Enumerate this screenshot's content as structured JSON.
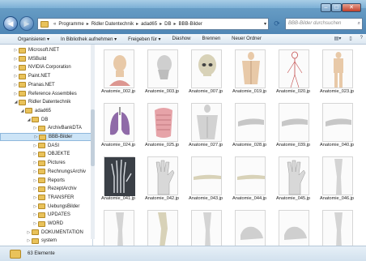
{
  "window": {
    "buttons": {
      "minimize_icon": "minimize-icon",
      "maximize_icon": "maximize-icon",
      "close_icon": "close-icon"
    }
  },
  "navigation": {
    "back_icon": "arrow-left-icon",
    "forward_icon": "arrow-right-icon",
    "breadcrumb": [
      {
        "label": "Programme"
      },
      {
        "label": "Ridler Datentechnik"
      },
      {
        "label": "adad65"
      },
      {
        "label": "DB"
      },
      {
        "label": "BBB-Bilder"
      }
    ],
    "refresh_icon": "refresh-icon",
    "search": {
      "placeholder": "BBB-Bilder durchsuchen"
    }
  },
  "toolbar": {
    "items": [
      {
        "label": "Organisieren ▾"
      },
      {
        "label": "In Bibliothek aufnehmen ▾"
      },
      {
        "label": "Freigeben für ▾"
      },
      {
        "label": "Diashow"
      },
      {
        "label": "Brennen"
      },
      {
        "label": "Neuer Ordner"
      }
    ],
    "right_icons": [
      "view-options-icon",
      "preview-pane-icon",
      "help-icon"
    ]
  },
  "sidebar": {
    "items": [
      {
        "label": "Microsoft.NET",
        "level": 0,
        "expanded": false
      },
      {
        "label": "MSBuild",
        "level": 0,
        "expanded": false
      },
      {
        "label": "NVIDIA Corporation",
        "level": 0,
        "expanded": false
      },
      {
        "label": "Paint.NET",
        "level": 0,
        "expanded": false
      },
      {
        "label": "Pranas.NET",
        "level": 0,
        "expanded": false
      },
      {
        "label": "Reference Assemblies",
        "level": 0,
        "expanded": false
      },
      {
        "label": "Ridler Datentechnik",
        "level": 0,
        "expanded": true
      },
      {
        "label": "adad65",
        "level": 1,
        "expanded": true
      },
      {
        "label": "DB",
        "level": 2,
        "expanded": true
      },
      {
        "label": "ArchivBankDTA",
        "level": 3,
        "expanded": false
      },
      {
        "label": "BBB-Bilder",
        "level": 3,
        "expanded": false,
        "selected": true
      },
      {
        "label": "DASI",
        "level": 3,
        "expanded": false
      },
      {
        "label": "OBJEKTE",
        "level": 3,
        "expanded": false
      },
      {
        "label": "Pictures",
        "level": 3,
        "expanded": false
      },
      {
        "label": "RechnungsArchiv",
        "level": 3,
        "expanded": false
      },
      {
        "label": "Reports",
        "level": 3,
        "expanded": false
      },
      {
        "label": "RezeptArchiv",
        "level": 3,
        "expanded": false
      },
      {
        "label": "TRANSFER",
        "level": 3,
        "expanded": false
      },
      {
        "label": "UebungsBilder",
        "level": 3,
        "expanded": false
      },
      {
        "label": "UPDATES",
        "level": 3,
        "expanded": false
      },
      {
        "label": "WORD",
        "level": 3,
        "expanded": false
      },
      {
        "label": "DOKUMENTATION",
        "level": 2,
        "expanded": false
      },
      {
        "label": "system",
        "level": 2,
        "expanded": false
      }
    ]
  },
  "files": [
    {
      "name": "Anatomie_002.jp",
      "image": "head-back-icon"
    },
    {
      "name": "Anatomie_003.jp",
      "image": "head-side-icon"
    },
    {
      "name": "Anatomie_007.jp",
      "image": "skull-icon"
    },
    {
      "name": "Anatomie_019.jp",
      "image": "torso-back-icon"
    },
    {
      "name": "Anatomie_020.jp",
      "image": "nervous-system-icon"
    },
    {
      "name": "Anatomie_023.jp",
      "image": "body-front-icon"
    },
    {
      "name": "Anatomie_024.jp",
      "image": "lungs-icon"
    },
    {
      "name": "Anatomie_025.jp",
      "image": "ribcage-icon"
    },
    {
      "name": "Anatomie_027.jp",
      "image": "torso-front-icon"
    },
    {
      "name": "Anatomie_028.jp",
      "image": "arm-icon"
    },
    {
      "name": "Anatomie_039.jp",
      "image": "arm-icon"
    },
    {
      "name": "Anatomie_040.jp",
      "image": "arm-icon"
    },
    {
      "name": "Anatomie_041.jp",
      "image": "hand-skeleton-icon"
    },
    {
      "name": "Anatomie_042.jp",
      "image": "hand-icon"
    },
    {
      "name": "Anatomie_043.jp",
      "image": "forearm-icon"
    },
    {
      "name": "Anatomie_044.jp",
      "image": "forearm-icon"
    },
    {
      "name": "Anatomie_045.jp",
      "image": "hand-icon"
    },
    {
      "name": "Anatomie_046.jp",
      "image": "leg-icon"
    },
    {
      "name": "",
      "image": "leg-icon"
    },
    {
      "name": "",
      "image": "knee-icon"
    },
    {
      "name": "",
      "image": "leg-icon"
    },
    {
      "name": "",
      "image": "foot-icon"
    },
    {
      "name": "",
      "image": "foot-icon"
    },
    {
      "name": "",
      "image": "leg-icon"
    }
  ],
  "status": {
    "count": "63 Elemente",
    "icon": "folder-icon"
  },
  "colors": {
    "frame": "#5b90bd",
    "selection": "#cce4f7",
    "folder": "#e9c25a",
    "lung_purple": "#8f6aa8",
    "muscle_red": "#c8544a",
    "skin": "#e8c9a8",
    "bone": "#d8d2b8"
  }
}
